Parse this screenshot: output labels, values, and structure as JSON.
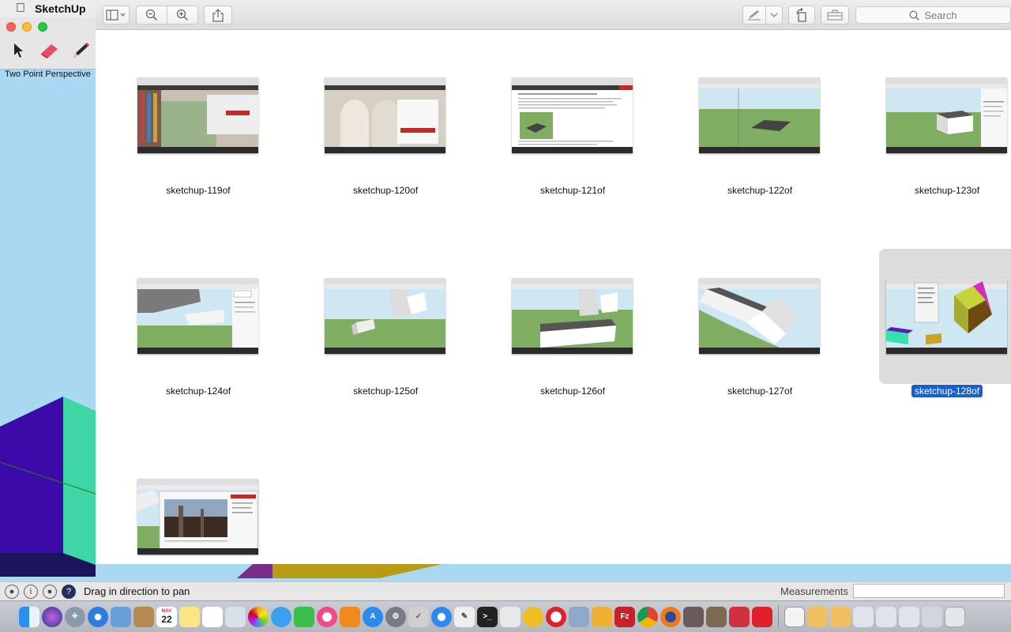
{
  "menubar": {
    "app_name": "SketchUp"
  },
  "sketchup": {
    "scene_label": "Two Point Perspective",
    "status_text": "Drag in direction to pan",
    "measurements_label": "Measurements",
    "tools": [
      "select-tool",
      "eraser-tool",
      "pencil-tool"
    ]
  },
  "quicklook": {
    "toolbar": {
      "search_placeholder": "Search",
      "buttons": [
        "sidebar-toggle",
        "zoom-out",
        "zoom-in",
        "share",
        "markup",
        "rotate",
        "toolbox"
      ]
    },
    "items": [
      {
        "name": "sketchup-119of",
        "selected": false
      },
      {
        "name": "sketchup-120of",
        "selected": false
      },
      {
        "name": "sketchup-121of",
        "selected": false
      },
      {
        "name": "sketchup-122of",
        "selected": false
      },
      {
        "name": "sketchup-123of",
        "selected": false
      },
      {
        "name": "sketchup-124of",
        "selected": false
      },
      {
        "name": "sketchup-125of",
        "selected": false
      },
      {
        "name": "sketchup-126of",
        "selected": false
      },
      {
        "name": "sketchup-127of",
        "selected": false
      },
      {
        "name": "sketchup-128of",
        "selected": true
      },
      {
        "name": "sketchup-129of",
        "selected": false
      }
    ]
  },
  "dock": {
    "calendar_date": "22",
    "calendar_month": "MAY",
    "apps": [
      "finder",
      "siri",
      "launchpad",
      "safari",
      "preview",
      "contacts",
      "calendar",
      "notes",
      "reminders",
      "photos-app",
      "photos",
      "messages",
      "facetime",
      "itunes",
      "ibooks",
      "app-store",
      "system-preferences",
      "script-editor",
      "quicktime",
      "textedit",
      "terminal",
      "elephant",
      "audacity",
      "opera",
      "finder-2",
      "coderunner",
      "filezilla",
      "chrome",
      "firefox",
      "image-editor",
      "gimp",
      "sketchup-alt",
      "sketchup"
    ],
    "right": [
      "preview-doc",
      "folder-1",
      "folder-2",
      "folder-3",
      "folder-4",
      "folder-5",
      "folder-6",
      "trash"
    ]
  }
}
